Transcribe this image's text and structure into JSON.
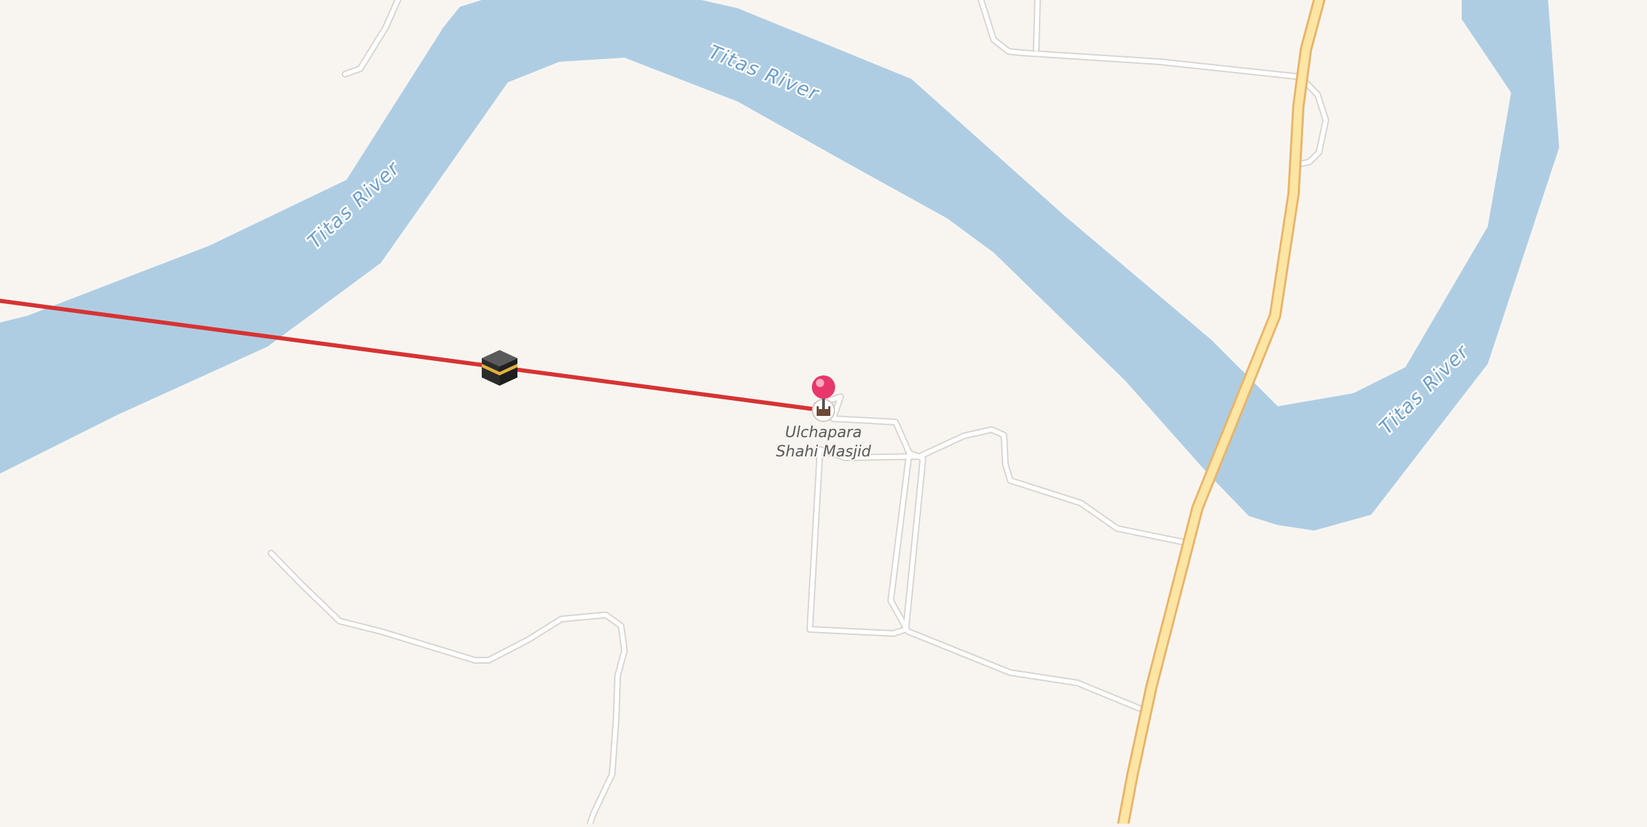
{
  "map": {
    "colors": {
      "land": "#f8f5f1",
      "water": "#aecde3",
      "road_casing": "#d9d4cf",
      "road_fill": "#ffffff",
      "primary_road_casing": "#e8b46a",
      "primary_road_fill": "#fde5a3",
      "qibla_line": "#d63333",
      "pin": "#e8386b"
    },
    "rivers": [
      {
        "label": "Titas River"
      },
      {
        "label": "Titas River"
      },
      {
        "label": "Titas River"
      }
    ],
    "poi": {
      "name_line1": "Ulchapara",
      "name_line2": "Shahi Masjid",
      "icon": "mosque-icon"
    },
    "markers": {
      "selected_pin": "location-pin-icon",
      "kaaba": "kaaba-icon"
    }
  }
}
